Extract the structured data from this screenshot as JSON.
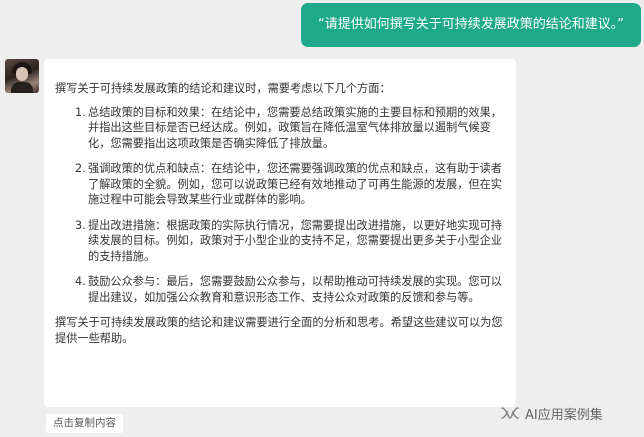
{
  "user_message": {
    "text": "“请提供如何撰写关于可持续发展政策的结论和建议。”"
  },
  "assistant": {
    "avatar_icon": "user-photo-avatar",
    "intro": "撰写关于可持续发展政策的结论和建议时，需要考虑以下几个方面：",
    "points": [
      {
        "num": "1.",
        "text": "总结政策的目标和效果：在结论中，您需要总结政策实施的主要目标和预期的效果，并指出这些目标是否已经达成。例如，政策旨在降低温室气体排放量以遏制气候变化，您需要指出这项政策是否确实降低了排放量。"
      },
      {
        "num": "2.",
        "text": "强调政策的优点和缺点：在结论中，您还需要强调政策的优点和缺点，这有助于读者了解政策的全貌。例如，您可以说政策已经有效地推动了可再生能源的发展，但在实施过程中可能会导致某些行业或群体的影响。"
      },
      {
        "num": "3.",
        "text": "提出改进措施：根据政策的实际执行情况，您需要提出改进措施，以更好地实现可持续发展的目标。例如，政策对于小型企业的支持不足，您需要提出更多关于小型企业的支持措施。"
      },
      {
        "num": "4.",
        "text": "鼓励公众参与：最后，您需要鼓励公众参与，以帮助推动可持续发展的实现。您可以提出建议，如加强公众教育和意识形态工作、支持公众对政策的反馈和参与等。"
      }
    ],
    "conclusion": "撰写关于可持续发展政策的结论和建议需要进行全面的分析和思考。希望这些建议可以为您提供一些帮助。"
  },
  "actions": {
    "copy_label": "点击复制内容"
  },
  "watermark": {
    "icon": "wechat-channel-icon",
    "text": "AI应用案例集"
  },
  "colors": {
    "background": "#eeeeee",
    "user_bubble": "#1eaa8a",
    "card": "#ffffff",
    "text": "#333333"
  }
}
